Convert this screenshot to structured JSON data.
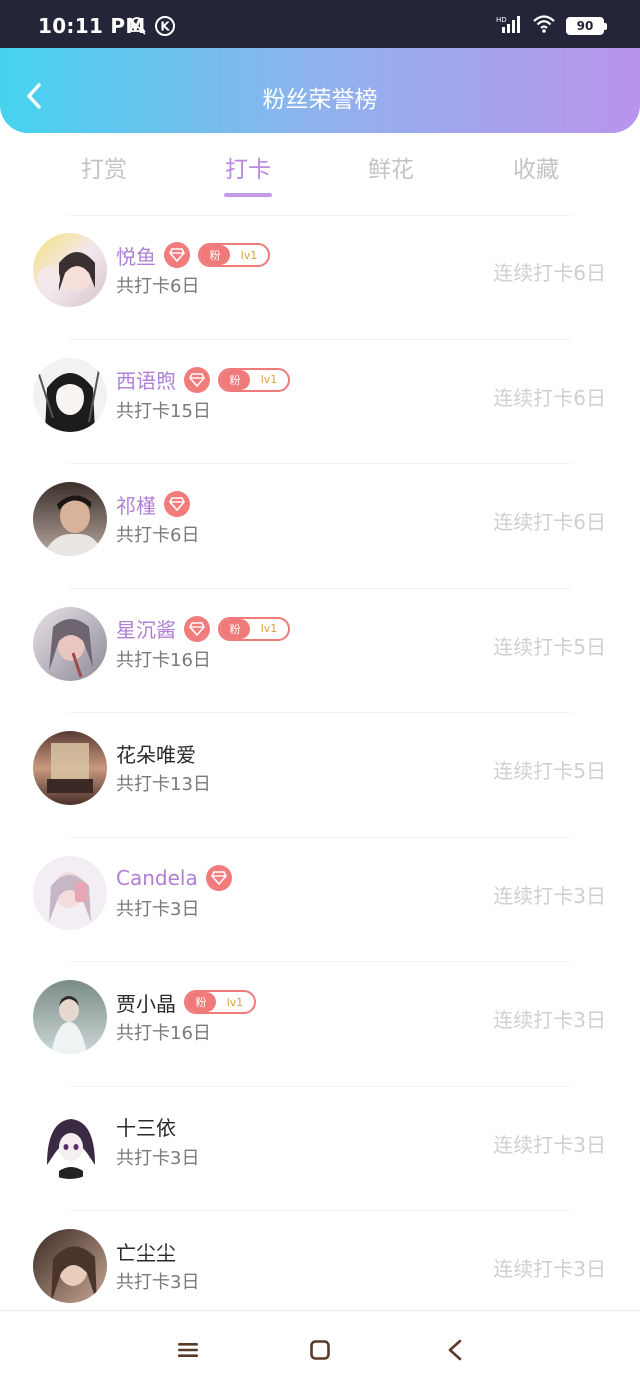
{
  "status_bar": {
    "time": "10:11 PM",
    "battery": "90",
    "network": "HD"
  },
  "header": {
    "title": "粉丝荣誉榜"
  },
  "tabs": [
    {
      "label": "打赏",
      "active": false
    },
    {
      "label": "打卡",
      "active": true
    },
    {
      "label": "鲜花",
      "active": false
    },
    {
      "label": "收藏",
      "active": false
    }
  ],
  "fans": [
    {
      "name": "悦鱼",
      "total": "共打卡6日",
      "streak": "连续打卡6日",
      "vip": true,
      "fan_badge": {
        "tag": "粉",
        "level": "lv1"
      }
    },
    {
      "name": "西语煦",
      "total": "共打卡15日",
      "streak": "连续打卡6日",
      "vip": true,
      "fan_badge": {
        "tag": "粉",
        "level": "lv1"
      }
    },
    {
      "name": "祁槿",
      "total": "共打卡6日",
      "streak": "连续打卡6日",
      "vip": true,
      "fan_badge": null
    },
    {
      "name": "星沉酱",
      "total": "共打卡16日",
      "streak": "连续打卡5日",
      "vip": true,
      "fan_badge": {
        "tag": "粉",
        "level": "lv1"
      }
    },
    {
      "name": "花朵唯爱",
      "total": "共打卡13日",
      "streak": "连续打卡5日",
      "vip": false,
      "fan_badge": null
    },
    {
      "name": "Candela",
      "total": "共打卡3日",
      "streak": "连续打卡3日",
      "vip": true,
      "fan_badge": null
    },
    {
      "name": "贾小晶",
      "total": "共打卡16日",
      "streak": "连续打卡3日",
      "vip": false,
      "fan_badge": {
        "tag": "粉",
        "level": "lv1"
      }
    },
    {
      "name": "十三依",
      "total": "共打卡3日",
      "streak": "连续打卡3日",
      "vip": false,
      "fan_badge": null
    },
    {
      "name": "亡尘尘",
      "total": "共打卡3日",
      "streak": "连续打卡3日",
      "vip": false,
      "fan_badge": null
    }
  ],
  "colors": {
    "accent": "#b988e0",
    "vip_name": "#b07fd6",
    "badge": "#f07a7a",
    "header_start": "#45d3ef",
    "header_end": "#b994ec"
  },
  "nav": {
    "icons": [
      "menu-icon",
      "home-square-icon",
      "back-triangle-icon"
    ]
  }
}
